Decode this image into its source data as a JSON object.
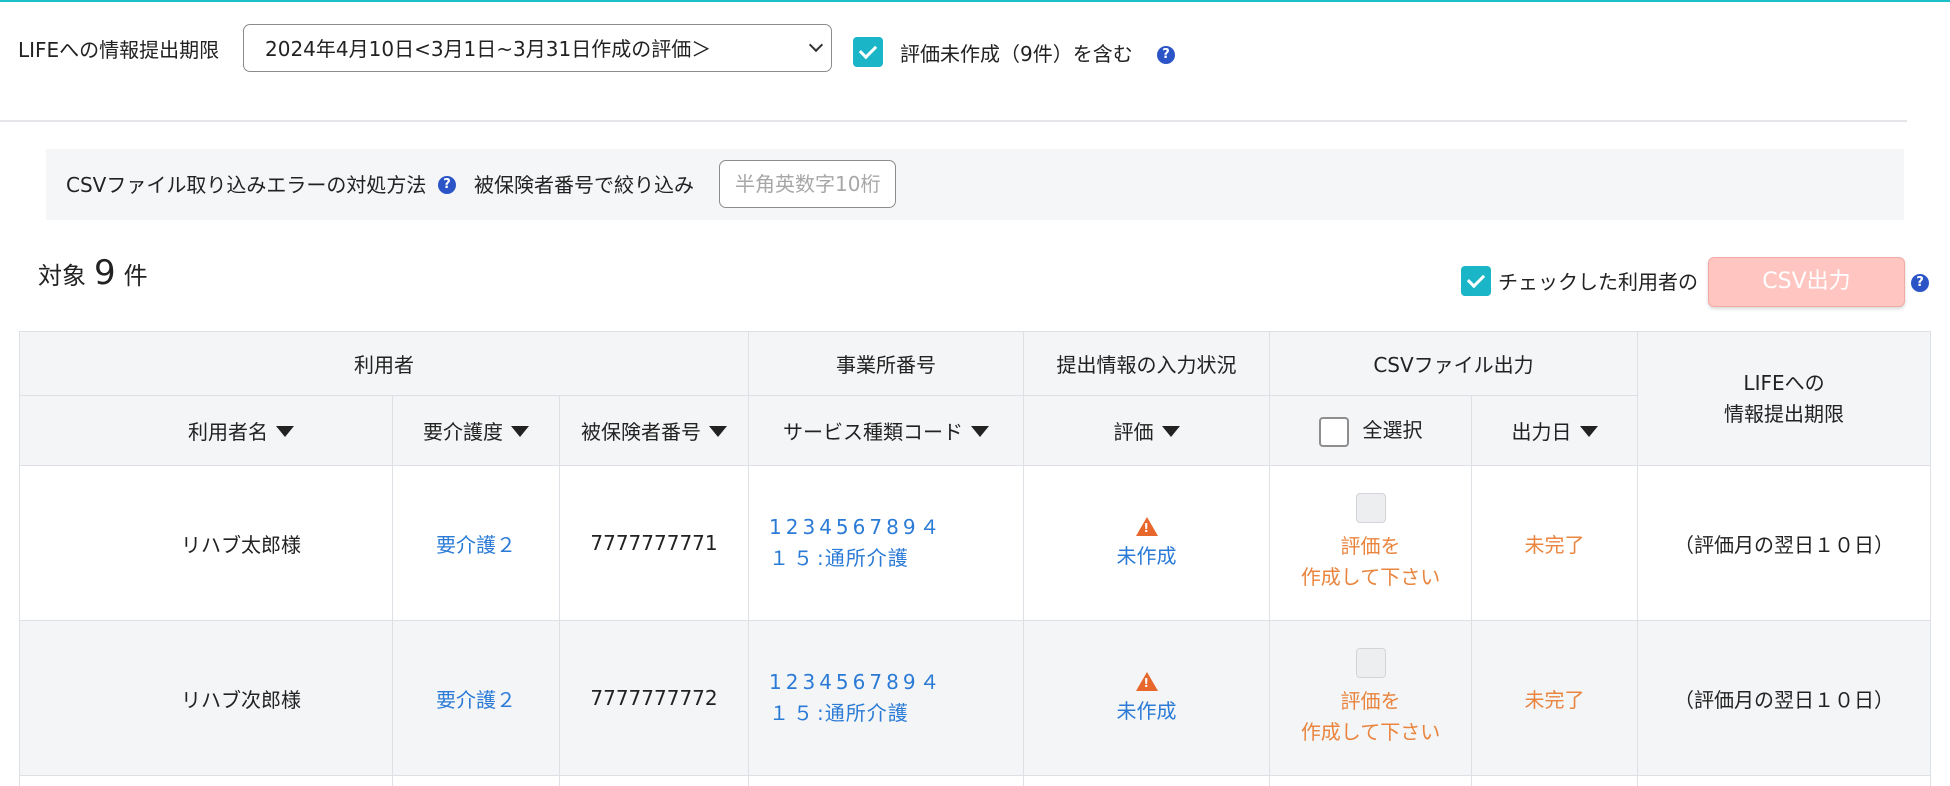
{
  "colors": {
    "accent": "#1ab5c6",
    "link": "#2b7bd6",
    "warning": "#e7672c",
    "incomplete": "#e9853f",
    "help": "#2b55c7",
    "csv_button": "#ffc6c1"
  },
  "filters": {
    "period_label": "LIFEへの情報提出期限",
    "period_value": "2024年4月10日<3月1日~3月31日作成の評価＞",
    "include_incomplete_label": "評価未作成（9件）を含む",
    "include_incomplete_checked": true
  },
  "csv_panel": {
    "help_text": "CSVファイル取り込みエラーの対処方法",
    "filter_label": "被保険者番号で絞り込み",
    "filter_placeholder": "半角英数字10桁",
    "filter_value": ""
  },
  "summary": {
    "count_prefix": "対象",
    "count": "9",
    "count_suffix": "件",
    "checked_users_label": "チェックした利用者の",
    "csv_button_label": "CSV出力"
  },
  "table": {
    "group_headers": {
      "user": "利用者",
      "office": "事業所番号",
      "input_status": "提出情報の入力状況",
      "csv_output": "CSVファイル出力",
      "deadline_line1": "LIFEへの",
      "deadline_line2": "情報提出期限"
    },
    "column_headers": {
      "user_name": "利用者名",
      "care_level": "要介護度",
      "insured_number": "被保険者番号",
      "service_code": "サービス種類コード",
      "evaluation": "評価",
      "select_all": "全選択",
      "output_date": "出力日"
    },
    "rows": [
      {
        "user_name": "リハブ太郎様",
        "care_level": "要介護２",
        "insured_number": "7777777771",
        "service_line1": "123456789４",
        "service_line2_code": "１５",
        "service_line2_name": ":通所介護",
        "evaluation": "未作成",
        "csv_line1": "評価を",
        "csv_line2": "作成して下さい",
        "output_date": "未完了",
        "deadline": "（評価月の翌日１０日）"
      },
      {
        "user_name": "リハブ次郎様",
        "care_level": "要介護２",
        "insured_number": "7777777772",
        "service_line1": "123456789４",
        "service_line2_code": "１５",
        "service_line2_name": ":通所介護",
        "evaluation": "未作成",
        "csv_line1": "評価を",
        "csv_line2": "作成して下さい",
        "output_date": "未完了",
        "deadline": "（評価月の翌日１０日）"
      }
    ]
  }
}
